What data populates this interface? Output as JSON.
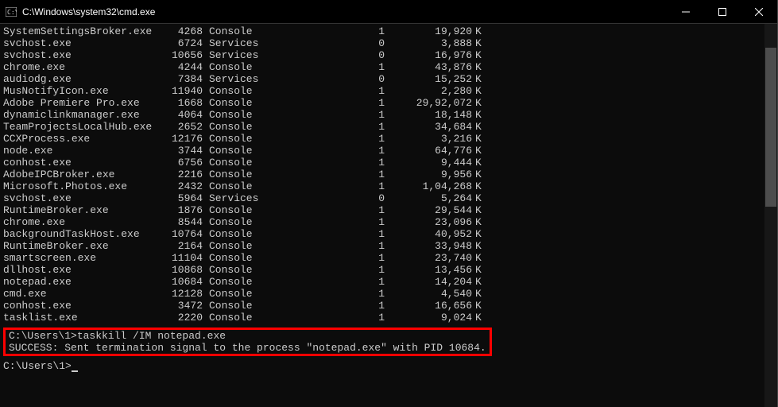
{
  "titlebar": {
    "title": "C:\\Windows\\system32\\cmd.exe"
  },
  "tasklist": [
    {
      "name": "SystemSettingsBroker.exe",
      "pid": "4268",
      "session": "Console",
      "sno": "1",
      "mem": "19,920",
      "k": "K"
    },
    {
      "name": "svchost.exe",
      "pid": "6724",
      "session": "Services",
      "sno": "0",
      "mem": "3,888",
      "k": "K"
    },
    {
      "name": "svchost.exe",
      "pid": "10656",
      "session": "Services",
      "sno": "0",
      "mem": "16,976",
      "k": "K"
    },
    {
      "name": "chrome.exe",
      "pid": "4244",
      "session": "Console",
      "sno": "1",
      "mem": "43,876",
      "k": "K"
    },
    {
      "name": "audiodg.exe",
      "pid": "7384",
      "session": "Services",
      "sno": "0",
      "mem": "15,252",
      "k": "K"
    },
    {
      "name": "MusNotifyIcon.exe",
      "pid": "11940",
      "session": "Console",
      "sno": "1",
      "mem": "2,280",
      "k": "K"
    },
    {
      "name": "Adobe Premiere Pro.exe",
      "pid": "1668",
      "session": "Console",
      "sno": "1",
      "mem": "29,92,072",
      "k": "K"
    },
    {
      "name": "dynamiclinkmanager.exe",
      "pid": "4064",
      "session": "Console",
      "sno": "1",
      "mem": "18,148",
      "k": "K"
    },
    {
      "name": "TeamProjectsLocalHub.exe",
      "pid": "2652",
      "session": "Console",
      "sno": "1",
      "mem": "34,684",
      "k": "K"
    },
    {
      "name": "CCXProcess.exe",
      "pid": "12176",
      "session": "Console",
      "sno": "1",
      "mem": "3,216",
      "k": "K"
    },
    {
      "name": "node.exe",
      "pid": "3744",
      "session": "Console",
      "sno": "1",
      "mem": "64,776",
      "k": "K"
    },
    {
      "name": "conhost.exe",
      "pid": "6756",
      "session": "Console",
      "sno": "1",
      "mem": "9,444",
      "k": "K"
    },
    {
      "name": "AdobeIPCBroker.exe",
      "pid": "2216",
      "session": "Console",
      "sno": "1",
      "mem": "9,956",
      "k": "K"
    },
    {
      "name": "Microsoft.Photos.exe",
      "pid": "2432",
      "session": "Console",
      "sno": "1",
      "mem": "1,04,268",
      "k": "K"
    },
    {
      "name": "svchost.exe",
      "pid": "5964",
      "session": "Services",
      "sno": "0",
      "mem": "5,264",
      "k": "K"
    },
    {
      "name": "RuntimeBroker.exe",
      "pid": "1876",
      "session": "Console",
      "sno": "1",
      "mem": "29,544",
      "k": "K"
    },
    {
      "name": "chrome.exe",
      "pid": "8544",
      "session": "Console",
      "sno": "1",
      "mem": "23,096",
      "k": "K"
    },
    {
      "name": "backgroundTaskHost.exe",
      "pid": "10764",
      "session": "Console",
      "sno": "1",
      "mem": "40,952",
      "k": "K"
    },
    {
      "name": "RuntimeBroker.exe",
      "pid": "2164",
      "session": "Console",
      "sno": "1",
      "mem": "33,948",
      "k": "K"
    },
    {
      "name": "smartscreen.exe",
      "pid": "11104",
      "session": "Console",
      "sno": "1",
      "mem": "23,740",
      "k": "K"
    },
    {
      "name": "dllhost.exe",
      "pid": "10868",
      "session": "Console",
      "sno": "1",
      "mem": "13,456",
      "k": "K"
    },
    {
      "name": "notepad.exe",
      "pid": "10684",
      "session": "Console",
      "sno": "1",
      "mem": "14,204",
      "k": "K"
    },
    {
      "name": "cmd.exe",
      "pid": "12128",
      "session": "Console",
      "sno": "1",
      "mem": "4,540",
      "k": "K"
    },
    {
      "name": "conhost.exe",
      "pid": "3472",
      "session": "Console",
      "sno": "1",
      "mem": "16,656",
      "k": "K"
    },
    {
      "name": "tasklist.exe",
      "pid": "2220",
      "session": "Console",
      "sno": "1",
      "mem": "9,024",
      "k": "K"
    }
  ],
  "command": {
    "prompt": "C:\\Users\\1>",
    "entered": "taskkill /IM notepad.exe",
    "result": "SUCCESS: Sent termination signal to the process \"notepad.exe\" with PID 10684."
  },
  "prompt2": "C:\\Users\\1>"
}
